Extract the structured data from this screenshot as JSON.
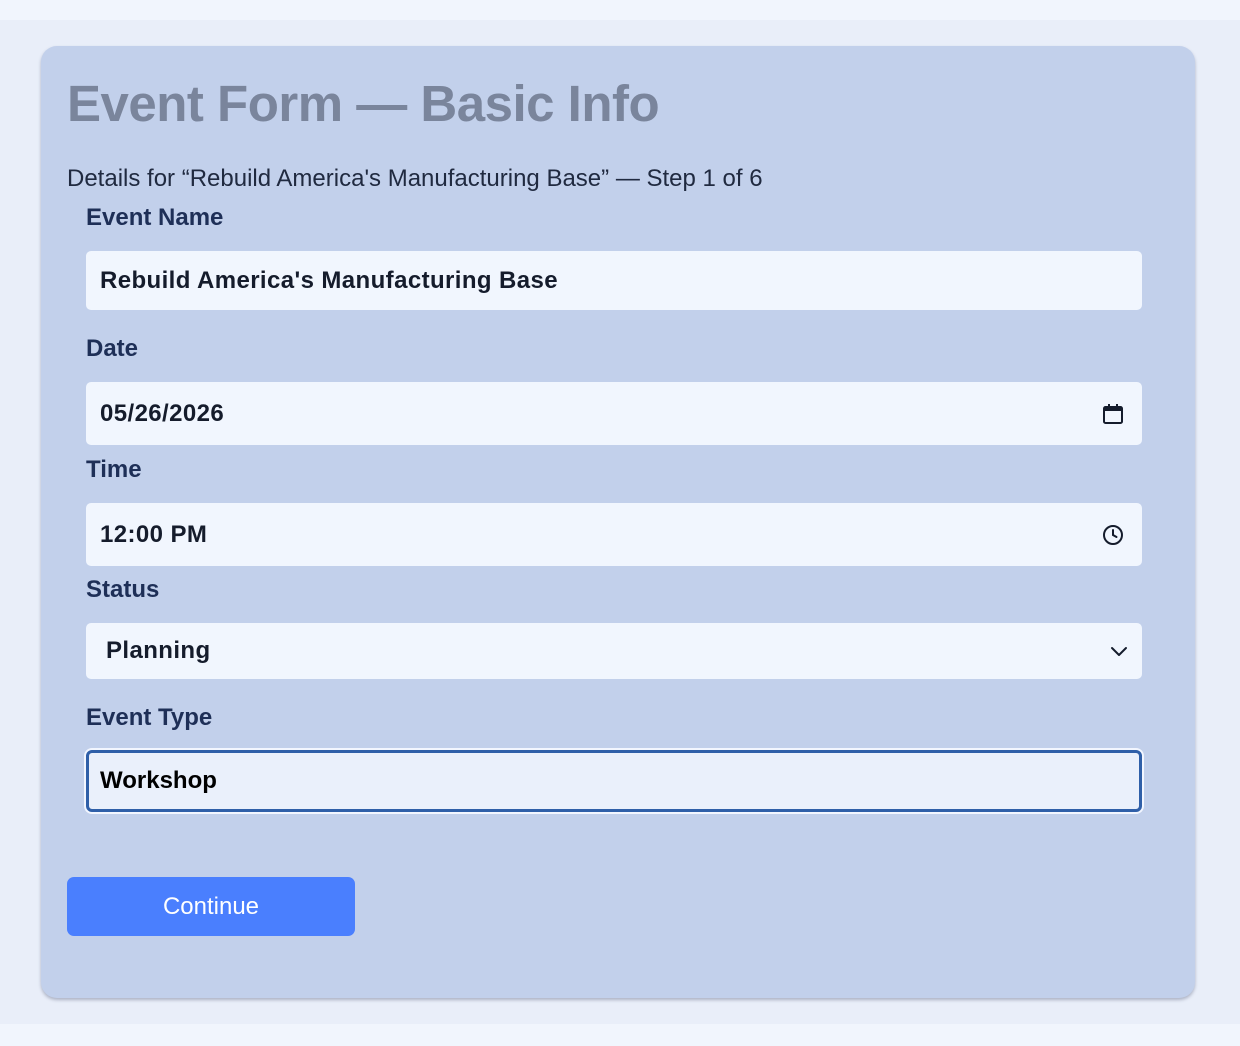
{
  "form": {
    "title": "Event Form — Basic Info",
    "subtitle": "Details for “Rebuild America's Manufacturing Base” — Step 1 of 6",
    "fields": {
      "event_name": {
        "label": "Event Name",
        "value": "Rebuild America's Manufacturing Base"
      },
      "date": {
        "label": "Date",
        "value": "05/26/2026",
        "icon": "calendar-icon"
      },
      "time": {
        "label": "Time",
        "value": "12:00 PM",
        "icon": "clock-icon"
      },
      "status": {
        "label": "Status",
        "value": "Planning",
        "icon": "chevron-down-icon"
      },
      "event_type": {
        "label": "Event Type",
        "value": "Workshop",
        "focused": true
      }
    },
    "continue_label": "Continue"
  },
  "colors": {
    "background": "#e9eef9",
    "card": "#c2d0eb",
    "field": "#f1f6fe",
    "focus_border": "#2f5fa8",
    "button": "#4a7ffe",
    "title": "#7a859c",
    "label": "#1e2f57"
  }
}
